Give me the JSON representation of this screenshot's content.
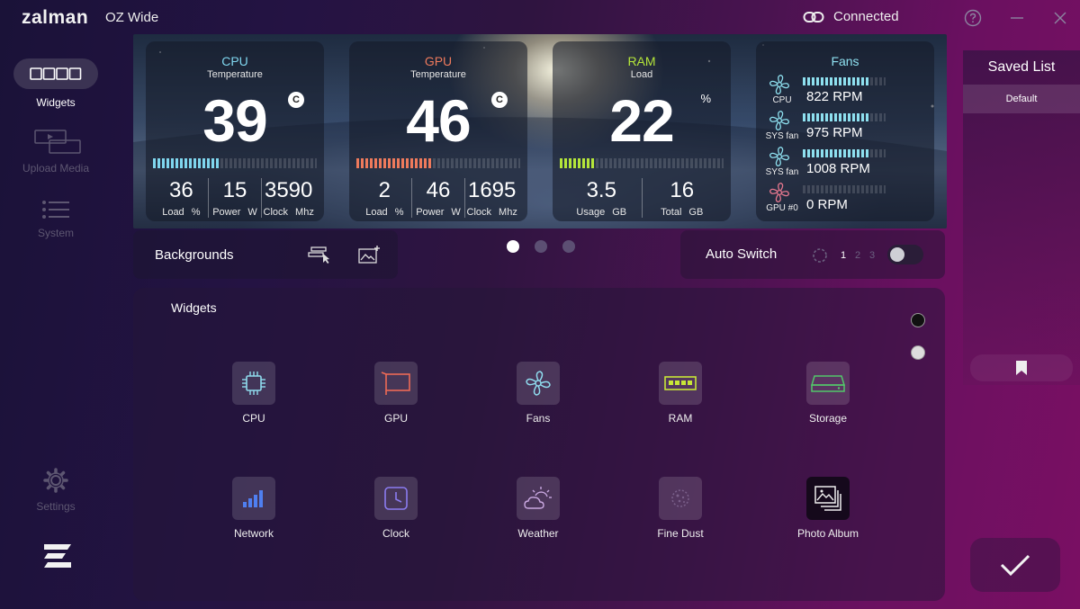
{
  "titlebar": {
    "logo": "zalman",
    "app_title": "OZ Wide",
    "connection_status": "Connected",
    "help_icon": "question-icon",
    "minimize_icon": "minimize-icon",
    "close_icon": "close-icon"
  },
  "sidebar": {
    "items": [
      {
        "label": "Widgets",
        "icon": "widgets-icon",
        "active": true
      },
      {
        "label": "Upload Media",
        "icon": "upload-media-icon",
        "active": false
      },
      {
        "label": "System",
        "icon": "list-icon",
        "active": false
      },
      {
        "label": "Settings",
        "icon": "gear-icon",
        "active": false
      }
    ]
  },
  "preview": {
    "cpu": {
      "title": "CPU",
      "subtitle": "Temperature",
      "value": "39",
      "unit": "C",
      "color": "#7fd6ee",
      "level": 0.4,
      "stats": [
        {
          "value": "36",
          "label": "Load",
          "unit": "%"
        },
        {
          "value": "15",
          "label": "Power",
          "unit": "W"
        },
        {
          "value": "3590",
          "label": "Clock",
          "unit": "Mhz"
        }
      ]
    },
    "gpu": {
      "title": "GPU",
      "subtitle": "Temperature",
      "value": "46",
      "unit": "C",
      "color": "#ee7a5c",
      "level": 0.46,
      "stats": [
        {
          "value": "2",
          "label": "Load",
          "unit": "%"
        },
        {
          "value": "46",
          "label": "Power",
          "unit": "W"
        },
        {
          "value": "1695",
          "label": "Clock",
          "unit": "Mhz"
        }
      ]
    },
    "ram": {
      "title": "RAM",
      "subtitle": "Load",
      "value": "22",
      "unit": "%",
      "color": "#b5e63a",
      "level": 0.22,
      "stats": [
        {
          "value": "3.5",
          "label": "Usage",
          "unit": "GB"
        },
        {
          "value": "16",
          "label": "Total",
          "unit": "GB"
        }
      ]
    },
    "fans": {
      "title": "Fans",
      "color": "#8ee0ef",
      "items": [
        {
          "label": "CPU",
          "rpm": "822 RPM",
          "color": "#8ee0ef",
          "level": 0.8
        },
        {
          "label": "SYS fan",
          "rpm": "975 RPM",
          "color": "#8ee0ef",
          "level": 0.8
        },
        {
          "label": "SYS fan",
          "rpm": "1008 RPM",
          "color": "#8ee0ef",
          "level": 0.8
        },
        {
          "label": "GPU #0",
          "rpm": "0 RPM",
          "color": "#e7788f",
          "level": 0.0
        }
      ]
    }
  },
  "backgrounds": {
    "label": "Backgrounds",
    "edit_icon": "edit-background-icon",
    "add_icon": "add-image-icon"
  },
  "pager": {
    "count": 3,
    "active": 0
  },
  "auto_switch": {
    "label": "Auto Switch",
    "timer_icon": "timer-icon",
    "options": [
      "1",
      "2",
      "3"
    ],
    "selected": "1",
    "enabled": false
  },
  "widgets": {
    "title": "Widgets",
    "items": [
      {
        "label": "CPU",
        "icon": "cpu-icon"
      },
      {
        "label": "GPU",
        "icon": "gpu-icon"
      },
      {
        "label": "Fans",
        "icon": "fan-icon"
      },
      {
        "label": "RAM",
        "icon": "ram-icon"
      },
      {
        "label": "Storage",
        "icon": "storage-icon"
      },
      {
        "label": "Network",
        "icon": "network-icon"
      },
      {
        "label": "Clock",
        "icon": "clock-icon"
      },
      {
        "label": "Weather",
        "icon": "weather-icon"
      },
      {
        "label": "Fine Dust",
        "icon": "fine-dust-icon"
      },
      {
        "label": "Photo Album",
        "icon": "photo-album-icon"
      }
    ],
    "theme_options": [
      "dark",
      "light"
    ]
  },
  "saved_list": {
    "title": "Saved List",
    "items": [
      "Default"
    ],
    "bookmark_icon": "bookmark-icon"
  },
  "confirm_icon": "checkmark-icon"
}
